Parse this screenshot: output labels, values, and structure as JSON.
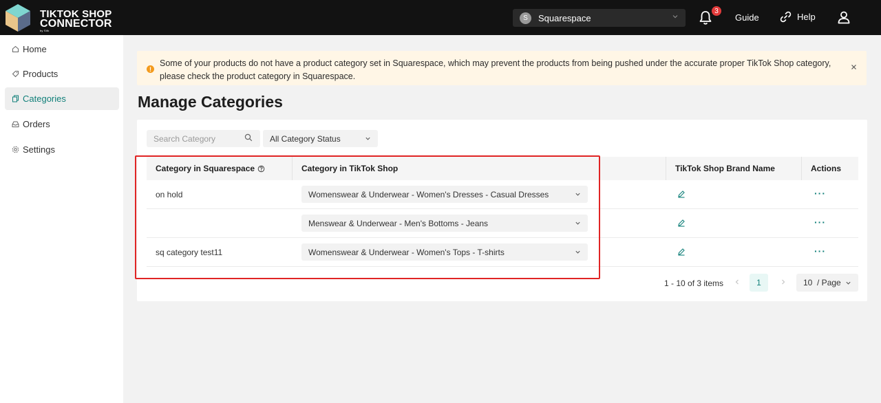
{
  "app": {
    "logo_line1": "TIKTOK SHOP",
    "logo_line2": "CONNECTOR",
    "logo_by": "by Sitk",
    "accent_color": "#12807a"
  },
  "topbar": {
    "shop_initial": "S",
    "shop_name": "Squarespace",
    "notification_count": "3",
    "guide_label": "Guide",
    "help_label": "Help"
  },
  "sidebar": {
    "items": [
      {
        "label": "Home",
        "icon": "home-icon"
      },
      {
        "label": "Products",
        "icon": "tag-icon"
      },
      {
        "label": "Categories",
        "icon": "copy-icon",
        "active": true
      },
      {
        "label": "Orders",
        "icon": "inbox-icon"
      },
      {
        "label": "Settings",
        "icon": "gear-icon"
      }
    ]
  },
  "banner": {
    "message": "Some of your products do not have a product category set in Squarespace, which may prevent the products from being pushed under the accurate proper TikTok Shop category, please check the product category in Squarespace."
  },
  "page": {
    "title": "Manage Categories"
  },
  "filters": {
    "search_placeholder": "Search Category",
    "status_value": "All Category Status"
  },
  "table": {
    "columns": [
      "Category in Squarespace",
      "Category in TikTok Shop",
      "TikTok Shop Brand Name",
      "Actions"
    ],
    "rows": [
      {
        "squarespace": "on hold",
        "tiktok": "Womenswear & Underwear - Women's Dresses - Casual Dresses"
      },
      {
        "squarespace": "",
        "tiktok": "Menswear & Underwear - Men's Bottoms - Jeans"
      },
      {
        "squarespace": "sq category test11",
        "tiktok": "Womenswear & Underwear - Women's Tops - T-shirts"
      }
    ]
  },
  "pagination": {
    "info": "1 - 10 of 3 items",
    "current_page": "1",
    "page_size": "10  / Page"
  }
}
